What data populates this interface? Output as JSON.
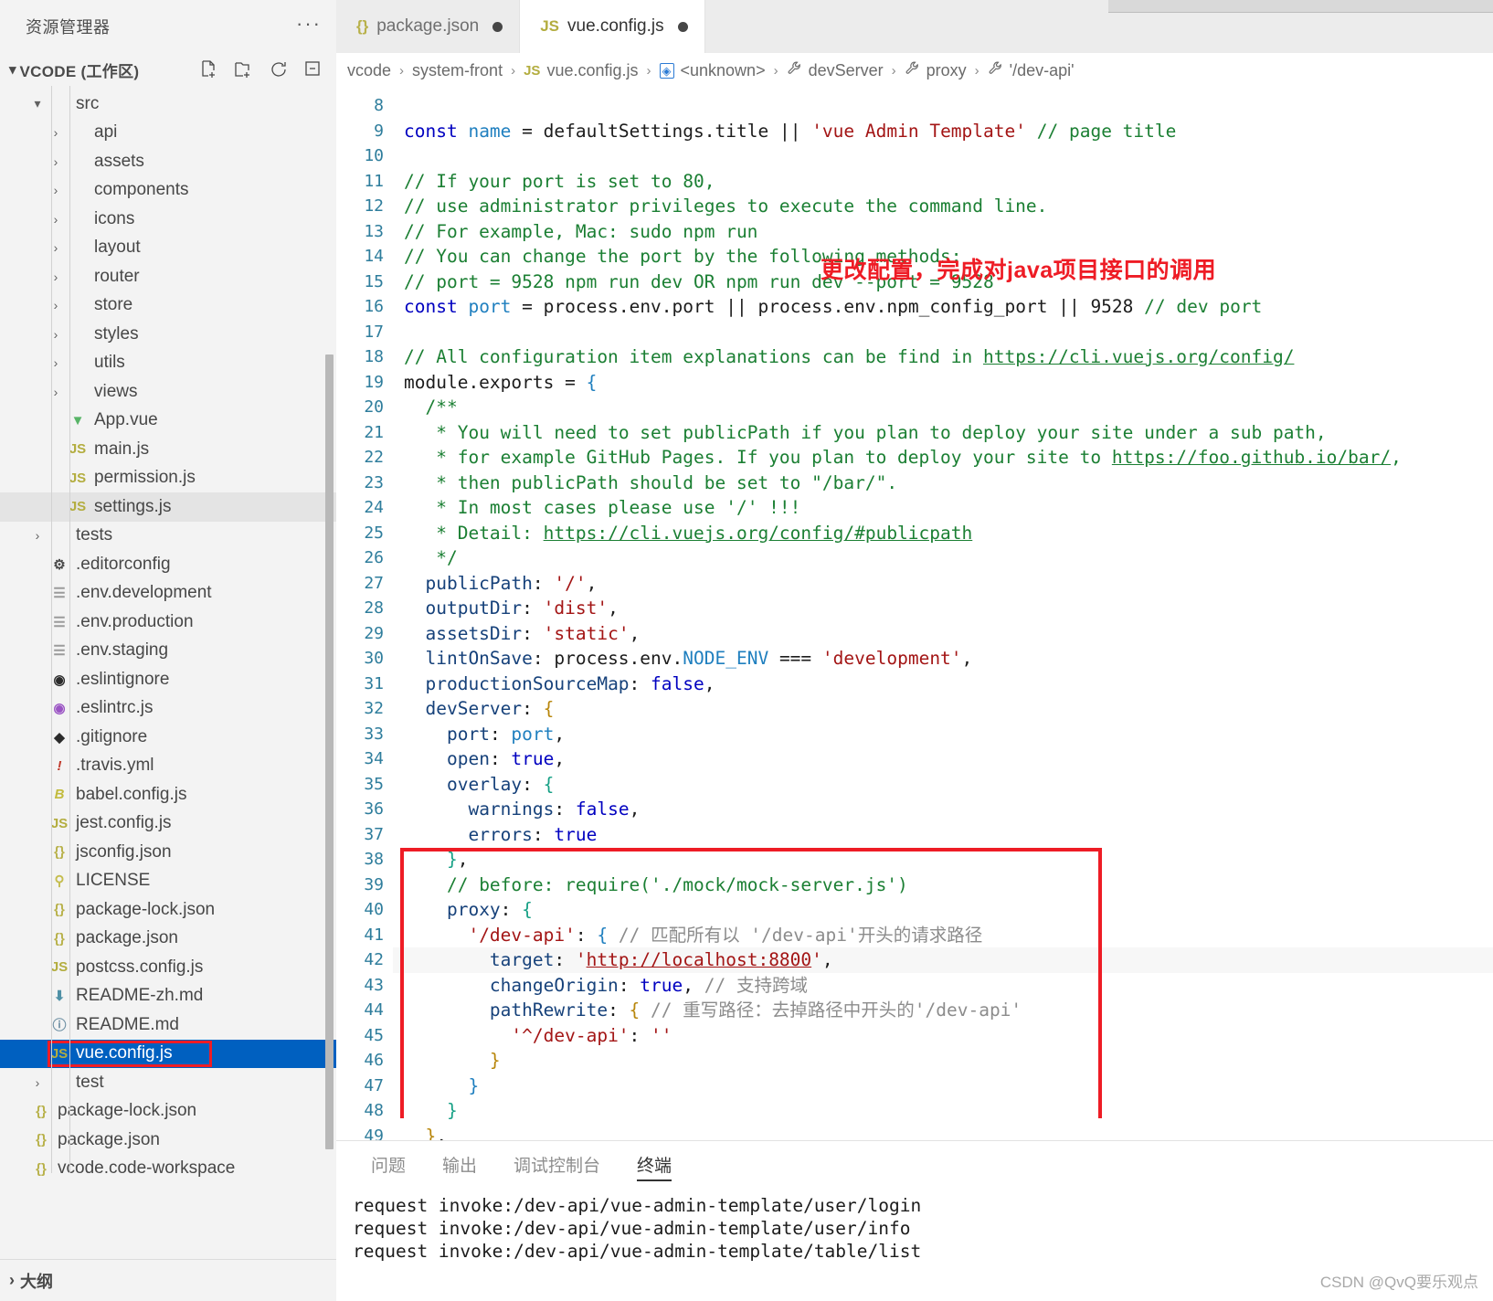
{
  "explorer": {
    "title": "资源管理器",
    "more_label": "···",
    "workspace_name": "VCODE (工作区)",
    "actions": [
      {
        "name": "new-file-icon",
        "label": "新建文件"
      },
      {
        "name": "new-folder-icon",
        "label": "新建文件夹"
      },
      {
        "name": "refresh-icon",
        "label": "刷新"
      },
      {
        "name": "collapse-all-icon",
        "label": "折叠文件夹"
      }
    ],
    "tree": [
      {
        "label": "src",
        "type": "folder",
        "expanded": true,
        "indent": 1,
        "icon": "chevron-down"
      },
      {
        "label": "api",
        "type": "folder",
        "expanded": false,
        "indent": 2,
        "icon": "chevron-right"
      },
      {
        "label": "assets",
        "type": "folder",
        "expanded": false,
        "indent": 2,
        "icon": "chevron-right"
      },
      {
        "label": "components",
        "type": "folder",
        "expanded": false,
        "indent": 2,
        "icon": "chevron-right"
      },
      {
        "label": "icons",
        "type": "folder",
        "expanded": false,
        "indent": 2,
        "icon": "chevron-right"
      },
      {
        "label": "layout",
        "type": "folder",
        "expanded": false,
        "indent": 2,
        "icon": "chevron-right"
      },
      {
        "label": "router",
        "type": "folder",
        "expanded": false,
        "indent": 2,
        "icon": "chevron-right"
      },
      {
        "label": "store",
        "type": "folder",
        "expanded": false,
        "indent": 2,
        "icon": "chevron-right"
      },
      {
        "label": "styles",
        "type": "folder",
        "expanded": false,
        "indent": 2,
        "icon": "chevron-right"
      },
      {
        "label": "utils",
        "type": "folder",
        "expanded": false,
        "indent": 2,
        "icon": "chevron-right"
      },
      {
        "label": "views",
        "type": "folder",
        "expanded": false,
        "indent": 2,
        "icon": "chevron-right"
      },
      {
        "label": "App.vue",
        "type": "file",
        "indent": 2,
        "icon": "vue-icon"
      },
      {
        "label": "main.js",
        "type": "file",
        "indent": 2,
        "icon": "js-icon"
      },
      {
        "label": "permission.js",
        "type": "file",
        "indent": 2,
        "icon": "js-icon"
      },
      {
        "label": "settings.js",
        "type": "file",
        "indent": 2,
        "icon": "js-icon",
        "state": "highlight"
      },
      {
        "label": "tests",
        "type": "folder",
        "expanded": false,
        "indent": 1,
        "icon": "chevron-right"
      },
      {
        "label": ".editorconfig",
        "type": "file",
        "indent": 1,
        "icon": "gear-icon"
      },
      {
        "label": ".env.development",
        "type": "file",
        "indent": 1,
        "icon": "env-icon"
      },
      {
        "label": ".env.production",
        "type": "file",
        "indent": 1,
        "icon": "env-icon"
      },
      {
        "label": ".env.staging",
        "type": "file",
        "indent": 1,
        "icon": "env-icon"
      },
      {
        "label": ".eslintignore",
        "type": "file",
        "indent": 1,
        "icon": "eslint-dark-icon"
      },
      {
        "label": ".eslintrc.js",
        "type": "file",
        "indent": 1,
        "icon": "eslint-purple-icon"
      },
      {
        "label": ".gitignore",
        "type": "file",
        "indent": 1,
        "icon": "git-icon"
      },
      {
        "label": ".travis.yml",
        "type": "file",
        "indent": 1,
        "icon": "yaml-icon"
      },
      {
        "label": "babel.config.js",
        "type": "file",
        "indent": 1,
        "icon": "babel-icon"
      },
      {
        "label": "jest.config.js",
        "type": "file",
        "indent": 1,
        "icon": "js-icon"
      },
      {
        "label": "jsconfig.json",
        "type": "file",
        "indent": 1,
        "icon": "json-icon"
      },
      {
        "label": "LICENSE",
        "type": "file",
        "indent": 1,
        "icon": "key-icon"
      },
      {
        "label": "package-lock.json",
        "type": "file",
        "indent": 1,
        "icon": "json-icon"
      },
      {
        "label": "package.json",
        "type": "file",
        "indent": 1,
        "icon": "json-icon"
      },
      {
        "label": "postcss.config.js",
        "type": "file",
        "indent": 1,
        "icon": "js-icon"
      },
      {
        "label": "README-zh.md",
        "type": "file",
        "indent": 1,
        "icon": "markdown-down-icon"
      },
      {
        "label": "README.md",
        "type": "file",
        "indent": 1,
        "icon": "markdown-info-icon"
      },
      {
        "label": "vue.config.js",
        "type": "file",
        "indent": 1,
        "icon": "js-icon",
        "state": "selected",
        "annotated": true
      },
      {
        "label": "test",
        "type": "folder",
        "expanded": false,
        "indent": 1,
        "icon": "chevron-right"
      },
      {
        "label": "package-lock.json",
        "type": "file",
        "indent": 0,
        "icon": "json-icon"
      },
      {
        "label": "package.json",
        "type": "file",
        "indent": 0,
        "icon": "json-icon"
      },
      {
        "label": "vcode.code-workspace",
        "type": "file",
        "indent": 0,
        "icon": "json-icon"
      }
    ],
    "outline_label": "大纲"
  },
  "tabs": [
    {
      "label": "package.json",
      "icon": "json-icon",
      "dirty": true,
      "active": false
    },
    {
      "label": "vue.config.js",
      "icon": "js-icon",
      "dirty": true,
      "active": true
    }
  ],
  "breadcrumb": [
    {
      "label": "vcode",
      "icon": null
    },
    {
      "label": "system-front",
      "icon": null
    },
    {
      "label": "vue.config.js",
      "icon": "js-icon"
    },
    {
      "label": "<unknown>",
      "icon": "module-badge-icon"
    },
    {
      "label": "devServer",
      "icon": "wrench-icon"
    },
    {
      "label": "proxy",
      "icon": "wrench-icon"
    },
    {
      "label": "'/dev-api'",
      "icon": "wrench-icon"
    }
  ],
  "editor": {
    "first_line_number": 8,
    "lines": [
      {
        "n": 8,
        "html": ""
      },
      {
        "n": 9,
        "html": "<span class=\"tk-kw\">const</span> <span class=\"tk-var\">name</span> <span class=\"tk-op\">=</span> defaultSettings.title <span class=\"tk-op\">||</span> <span class=\"tk-str\">'vue Admin Template'</span> <span class=\"tk-cmt\">// page title</span>"
      },
      {
        "n": 10,
        "html": ""
      },
      {
        "n": 11,
        "html": "<span class=\"tk-cmt\">// If your port is set to 80,</span>"
      },
      {
        "n": 12,
        "html": "<span class=\"tk-cmt\">// use administrator privileges to execute the command line.</span>"
      },
      {
        "n": 13,
        "html": "<span class=\"tk-cmt\">// For example, Mac: sudo npm run</span>"
      },
      {
        "n": 14,
        "html": "<span class=\"tk-cmt\">// You can change the port by the following methods:</span>"
      },
      {
        "n": 15,
        "html": "<span class=\"tk-cmt\">// port = 9528 npm run dev OR npm run dev --port = 9528</span>"
      },
      {
        "n": 16,
        "html": "<span class=\"tk-kw\">const</span> <span class=\"tk-var\">port</span> <span class=\"tk-op\">=</span> process.env.port <span class=\"tk-op\">||</span> process.env.npm_config_port <span class=\"tk-op\">||</span> <span class=\"tk-num\">9528</span> <span class=\"tk-cmt\">// dev port</span>"
      },
      {
        "n": 17,
        "html": ""
      },
      {
        "n": 18,
        "html": "<span class=\"tk-cmt\">// All configuration item explanations can be find in </span><span class=\"tk-link\">https://cli.vuejs.org/config/</span>"
      },
      {
        "n": 19,
        "html": "module.exports <span class=\"tk-op\">=</span> <span class=\"tk-brace1\">{</span>"
      },
      {
        "n": 20,
        "html": "  <span class=\"tk-cmt\">/**</span>"
      },
      {
        "n": 21,
        "html": "   <span class=\"tk-cmt\">* You will need to set publicPath if you plan to deploy your site under a sub path,</span>"
      },
      {
        "n": 22,
        "html": "   <span class=\"tk-cmt\">* for example GitHub Pages. If you plan to deploy your site to </span><span class=\"tk-link\">https://foo.github.io/bar/</span><span class=\"tk-cmt\">,</span>"
      },
      {
        "n": 23,
        "html": "   <span class=\"tk-cmt\">* then publicPath should be set to \"/bar/\".</span>"
      },
      {
        "n": 24,
        "html": "   <span class=\"tk-cmt\">* In most cases please use '/' !!!</span>"
      },
      {
        "n": 25,
        "html": "   <span class=\"tk-cmt\">* Detail: </span><span class=\"tk-link\">https://cli.vuejs.org/config/#publicpath</span>"
      },
      {
        "n": 26,
        "html": "   <span class=\"tk-cmt\">*/</span>"
      },
      {
        "n": 27,
        "html": "  <span class=\"tk-prop\">publicPath</span>: <span class=\"tk-str\">'/'</span>,"
      },
      {
        "n": 28,
        "html": "  <span class=\"tk-prop\">outputDir</span>: <span class=\"tk-str\">'dist'</span>,"
      },
      {
        "n": 29,
        "html": "  <span class=\"tk-prop\">assetsDir</span>: <span class=\"tk-str\">'static'</span>,"
      },
      {
        "n": 30,
        "html": "  <span class=\"tk-prop\">lintOnSave</span>: process.env.<span class=\"tk-const-caps\">NODE_ENV</span> <span class=\"tk-op\">===</span> <span class=\"tk-str\">'development'</span>,"
      },
      {
        "n": 31,
        "html": "  <span class=\"tk-prop\">productionSourceMap</span>: <span class=\"tk-kw\">false</span>,"
      },
      {
        "n": 32,
        "html": "  <span class=\"tk-prop\">devServer</span>: <span class=\"tk-brace2\">{</span>"
      },
      {
        "n": 33,
        "html": "    <span class=\"tk-prop\">port</span>: <span class=\"tk-var\">port</span>,"
      },
      {
        "n": 34,
        "html": "    <span class=\"tk-prop\">open</span>: <span class=\"tk-kw\">true</span>,"
      },
      {
        "n": 35,
        "html": "    <span class=\"tk-prop\">overlay</span>: <span class=\"tk-brace3\">{</span>"
      },
      {
        "n": 36,
        "html": "      <span class=\"tk-prop\">warnings</span>: <span class=\"tk-kw\">false</span>,"
      },
      {
        "n": 37,
        "html": "      <span class=\"tk-prop\">errors</span>: <span class=\"tk-kw\">true</span>"
      },
      {
        "n": 38,
        "html": "    <span class=\"tk-brace3\">}</span>,"
      },
      {
        "n": 39,
        "html": "    <span class=\"tk-cmt\">// before: require('./mock/mock-server.js')</span>"
      },
      {
        "n": 40,
        "html": "    <span class=\"tk-prop\">proxy</span>: <span class=\"tk-brace3\">{</span>"
      },
      {
        "n": 41,
        "html": "      <span class=\"tk-str\">'/dev-api'</span>: <span class=\"tk-brace1\">{</span> <span class=\"tk-cmt-gray\">// 匹配所有以 '/dev-api'开头的请求路径</span>"
      },
      {
        "n": 42,
        "html": "        <span class=\"tk-prop\">target</span>: <span class=\"tk-str\">'</span><span class=\"tk-link-red\">http://localhost:8800</span><span class=\"tk-str\">'</span>,",
        "hl": true
      },
      {
        "n": 43,
        "html": "        <span class=\"tk-prop\">changeOrigin</span>: <span class=\"tk-kw\">true</span>, <span class=\"tk-cmt-gray\">// 支持跨域</span>"
      },
      {
        "n": 44,
        "html": "        <span class=\"tk-prop\">pathRewrite</span>: <span class=\"tk-brace2\">{</span> <span class=\"tk-cmt-gray\">// 重写路径：去掉路径中开头的'/dev-api'</span>"
      },
      {
        "n": 45,
        "html": "          <span class=\"tk-str\">'^/dev-api'</span>: <span class=\"tk-str\">''</span>"
      },
      {
        "n": 46,
        "html": "        <span class=\"tk-brace2\">}</span>"
      },
      {
        "n": 47,
        "html": "      <span class=\"tk-brace1\">}</span>"
      },
      {
        "n": 48,
        "html": "    <span class=\"tk-brace3\">}</span>"
      },
      {
        "n": 49,
        "html": "  <span class=\"tk-brace2\">}</span>,"
      }
    ],
    "annotation": "更改配置，完成对java项目接口的调用"
  },
  "panel": {
    "tabs": [
      {
        "label": "问题",
        "active": false
      },
      {
        "label": "输出",
        "active": false
      },
      {
        "label": "调试控制台",
        "active": false
      },
      {
        "label": "终端",
        "active": true
      }
    ],
    "terminal_lines": [
      "request invoke:/dev-api/vue-admin-template/user/login",
      "request invoke:/dev-api/vue-admin-template/user/info",
      "request invoke:/dev-api/vue-admin-template/table/list"
    ]
  },
  "watermark": "CSDN @QvQ要乐观点",
  "colors": {
    "selection_blue": "#0060c0",
    "annotation_red": "#ee1c25",
    "comment_green": "#1b7f33",
    "string_red": "#a31515",
    "keyword_blue": "#0000c0"
  }
}
